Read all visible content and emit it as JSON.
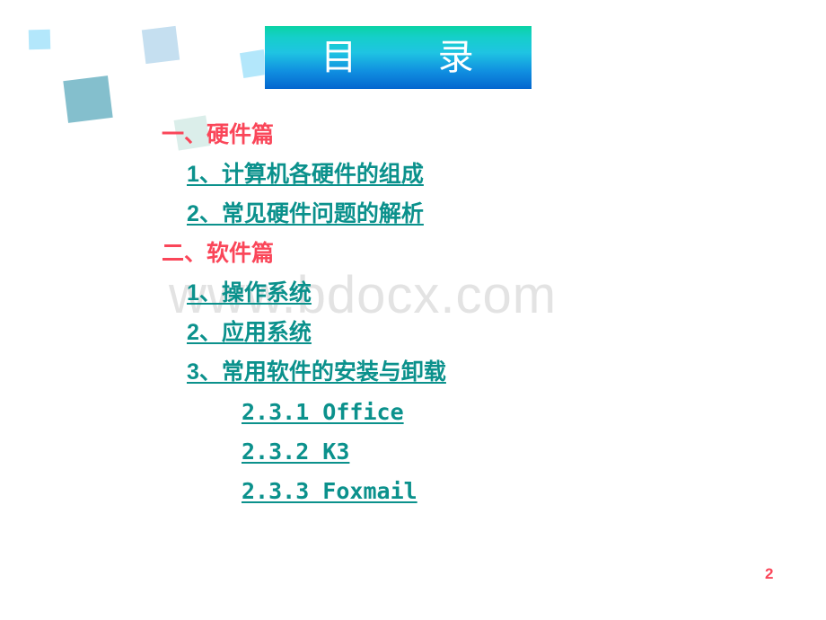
{
  "slide": {
    "background_color": "#ffffff",
    "page_number": "2",
    "page_number_color": "#fa4659"
  },
  "banner": {
    "title": "目      录",
    "gradient_from": "#0ad3a5",
    "gradient_to": "#0466cf",
    "text_color": "#ffffff"
  },
  "watermark": {
    "text": "www.bdocx.com",
    "color": "#e3e3e3"
  },
  "colors": {
    "heading_red": "#fa4659",
    "link_teal": "#0b918c",
    "deco_cyan": "#b3e7fb",
    "deco_pale_blue": "#c5dff0",
    "deco_steel_blue": "#84bfcd",
    "deco_mint": "#dbeeea"
  },
  "outline": [
    {
      "level": 1,
      "label": "一、硬件篇"
    },
    {
      "level": 2,
      "label": "1、计算机各硬件的组成"
    },
    {
      "level": 2,
      "label": "2、常见硬件问题的解析"
    },
    {
      "level": 1,
      "label": "二、软件篇"
    },
    {
      "level": 2,
      "label": "1、操作系统"
    },
    {
      "level": 2,
      "label": "2、应用系统"
    },
    {
      "level": 2,
      "label": "3、常用软件的安装与卸载"
    },
    {
      "level": 3,
      "label": "2.3.1 Office"
    },
    {
      "level": 3,
      "label": "2.3.2 K3"
    },
    {
      "level": 3,
      "label": "2.3.3 Foxmail"
    }
  ]
}
